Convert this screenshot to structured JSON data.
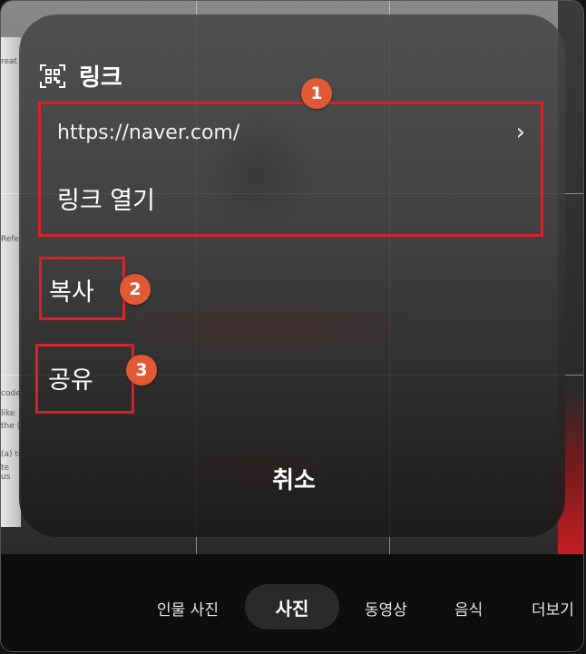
{
  "sheet": {
    "title": "링크",
    "title_icon": "qr-scan-icon",
    "url": "https://naver.com/",
    "chevron_icon": "chevron-right-icon",
    "open_link": "링크 열기",
    "copy": "복사",
    "share": "공유",
    "cancel": "취소"
  },
  "annotations": {
    "badge1": "1",
    "badge2": "2",
    "badge3": "3",
    "color": "#d9212a",
    "badge_color": "#e05a36"
  },
  "camera_modes": {
    "portrait": "인물 사진",
    "photo": "사진",
    "video": "동영상",
    "food": "음식",
    "more": "더보기"
  },
  "background_fragments": [
    "reat",
    "Refe",
    "code",
    "like",
    "the (",
    "(a) ti",
    "te us"
  ]
}
